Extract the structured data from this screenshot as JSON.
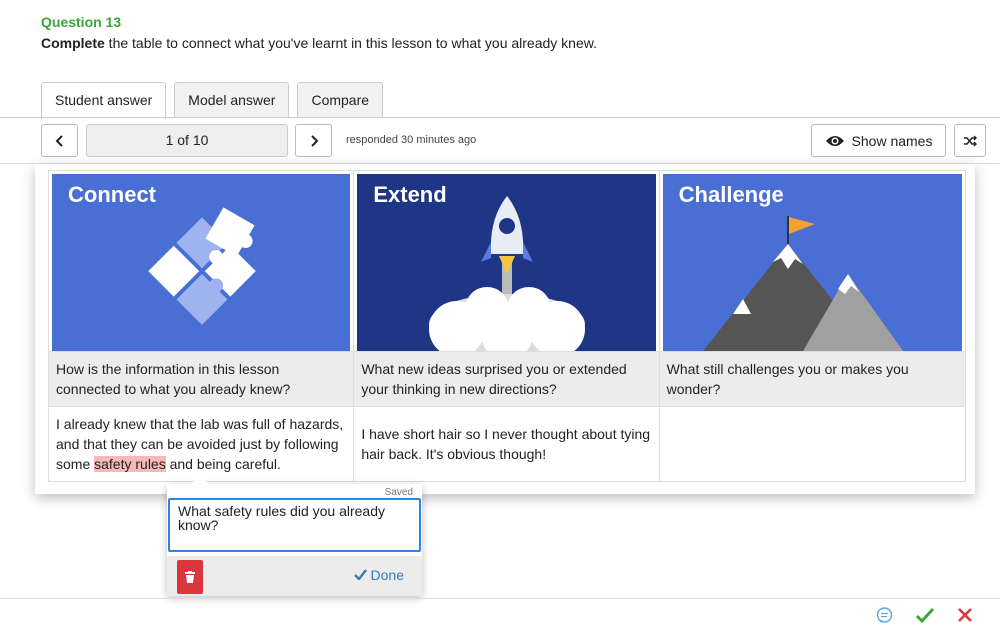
{
  "question": {
    "number": "Question 13",
    "instruction_bold": "Complete",
    "instruction_rest": " the table to connect what you've learnt in this lesson to what you already knew."
  },
  "tabs": [
    {
      "label": "Student answer",
      "active": true
    },
    {
      "label": "Model answer",
      "active": false
    },
    {
      "label": "Compare",
      "active": false
    }
  ],
  "toolbar": {
    "pager_text": "1 of 10",
    "responded": "responded 30 minutes ago",
    "show_names_label": "Show names"
  },
  "table": {
    "columns": [
      {
        "title": "Connect",
        "bg": "#4a6fd4",
        "prompt": "How is the information in this lesson connected to what you already knew?"
      },
      {
        "title": "Extend",
        "bg": "#1f3585",
        "prompt": "What new ideas surprised you or extended your thinking in new directions?"
      },
      {
        "title": "Challenge",
        "bg": "#4a6fd4",
        "prompt": "What still challenges you or makes you wonder?"
      }
    ],
    "answers": {
      "connect_pre": "I already knew that the lab was full of hazards, and that they can be avoided just by following some ",
      "connect_highlight": "safety rules",
      "connect_post": " and being careful.",
      "extend": "I have short hair so I never thought about tying hair back. It's obvious though!",
      "challenge": ""
    }
  },
  "comment_popup": {
    "saved_label": "Saved",
    "text": "What safety rules did you already know?",
    "done_label": "Done"
  },
  "colors": {
    "accent_green": "#3aa63a",
    "highlight": "#f7b8b8",
    "delete_red": "#d9363e",
    "link_blue": "#3a7ab8"
  },
  "icons": [
    "chevron-left-icon",
    "chevron-right-icon",
    "eye-icon",
    "shuffle-icon",
    "trash-icon",
    "check-icon",
    "comment-icon",
    "tick-icon",
    "cross-icon"
  ]
}
